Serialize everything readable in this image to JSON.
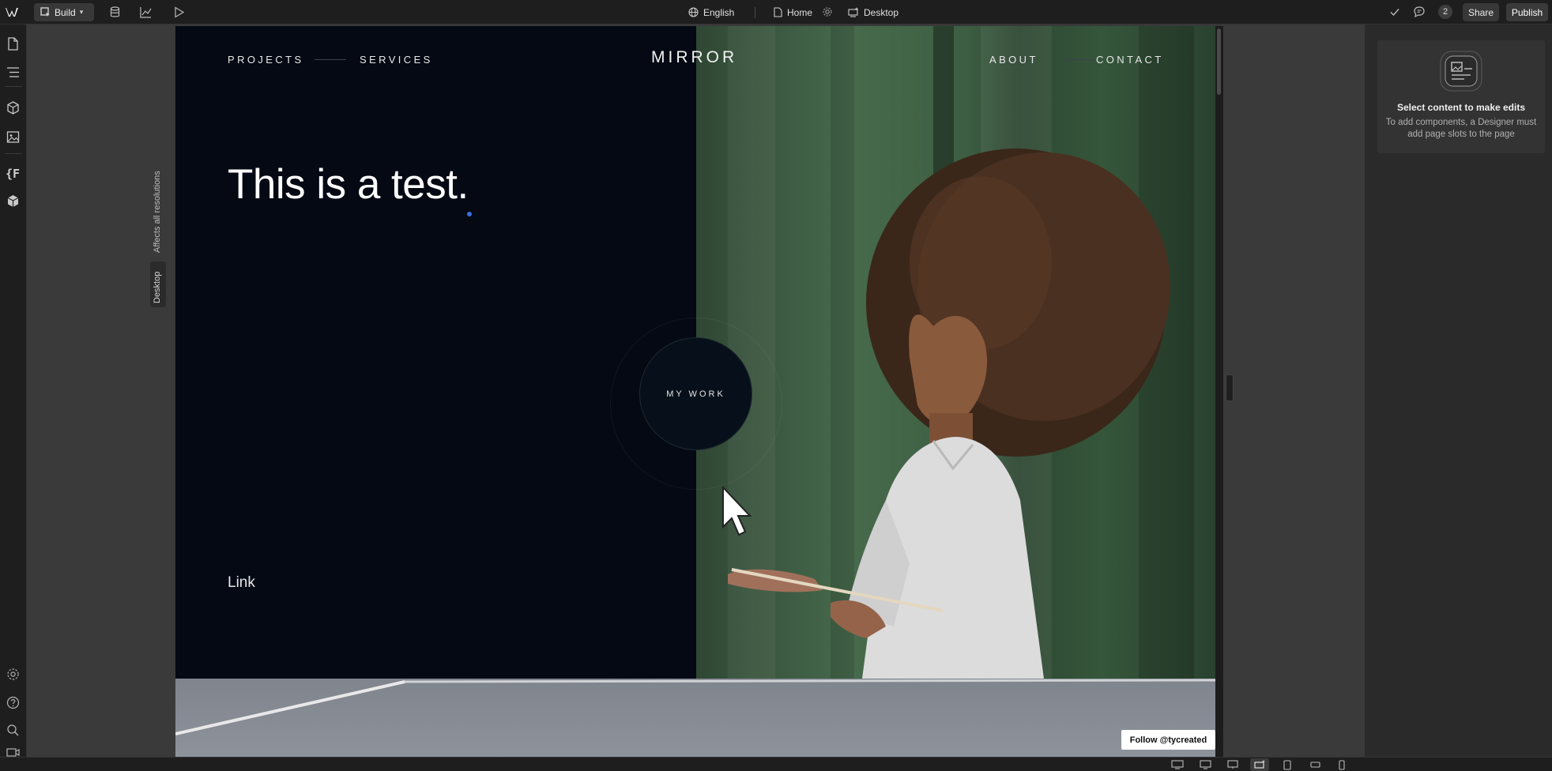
{
  "topbar": {
    "mode_label": "Build",
    "locale_label": "English",
    "page_label": "Home",
    "breakpoint_label": "Desktop",
    "comment_count": "2",
    "share_label": "Share",
    "publish_label": "Publish"
  },
  "canvas": {
    "affects_label": "Affects all resolutions",
    "breakpoint_tab_label": "Desktop"
  },
  "site": {
    "nav_left": [
      "PROJECTS",
      "SERVICES"
    ],
    "brand": "MIRROR",
    "nav_right": [
      "ABOUT",
      "CONTACT"
    ],
    "headline": "This is a test.",
    "cta_label": "MY WORK",
    "link_label": "Link",
    "follow_label": "Follow @tycreated"
  },
  "right_panel": {
    "title": "Select content to make edits",
    "description": "To add components, a Designer must add page slots to the page"
  },
  "colors": {
    "hero_dark": "#040913",
    "curtain_green": "#476a4c",
    "accent_dot": "#3b6fe0",
    "chrome": "#1e1e1e"
  },
  "icons": {
    "left_rail": [
      "pages-icon",
      "navigator-icon",
      "components-icon",
      "assets-icon",
      "variables-icon",
      "apps-icon",
      "settings-icon",
      "help-icon",
      "search-icon",
      "video-icon"
    ],
    "bottom_bar": [
      "desktop-large-icon",
      "desktop-icon",
      "desktop-base-icon",
      "desktop-active-icon",
      "tablet-icon",
      "mobile-landscape-icon",
      "mobile-portrait-icon"
    ]
  }
}
